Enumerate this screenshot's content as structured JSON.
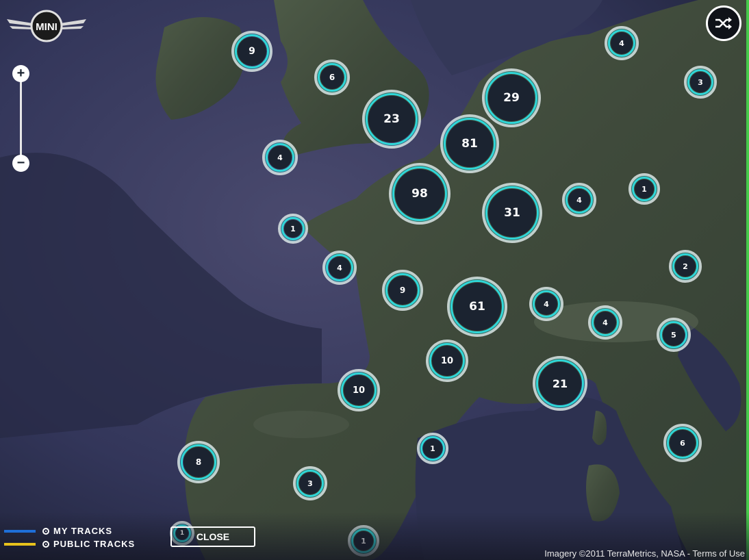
{
  "logo": {
    "text": "MINI"
  },
  "zoom": {
    "in_label": "+",
    "out_label": "−"
  },
  "toolbar": {
    "shuffle_icon": "shuffle-icon"
  },
  "legend": {
    "my_tracks": {
      "label": "MY TRACKS",
      "color": "#1e6fd9"
    },
    "public_tracks": {
      "label": "PUBLIC TRACKS",
      "color": "#e8c21c"
    }
  },
  "close_label": "CLOSE",
  "attribution": "Imagery ©2011  TerraMetrics, NASA - Terms of Use",
  "clusters": [
    "9",
    "6",
    "23",
    "29",
    "81",
    "98",
    "31",
    "4",
    "3",
    "4",
    "1",
    "4",
    "1",
    "2",
    "4",
    "9",
    "61",
    "4",
    "4",
    "5",
    "10",
    "21",
    "10",
    "1",
    "8",
    "3",
    "6",
    "1",
    "1"
  ],
  "colors": {
    "ring_accent": "#2fd6d8",
    "ring_outer": "#e6e6e6",
    "core": "#1b2330",
    "map_sea": "#2f3350",
    "map_land": "#3a4a36"
  }
}
